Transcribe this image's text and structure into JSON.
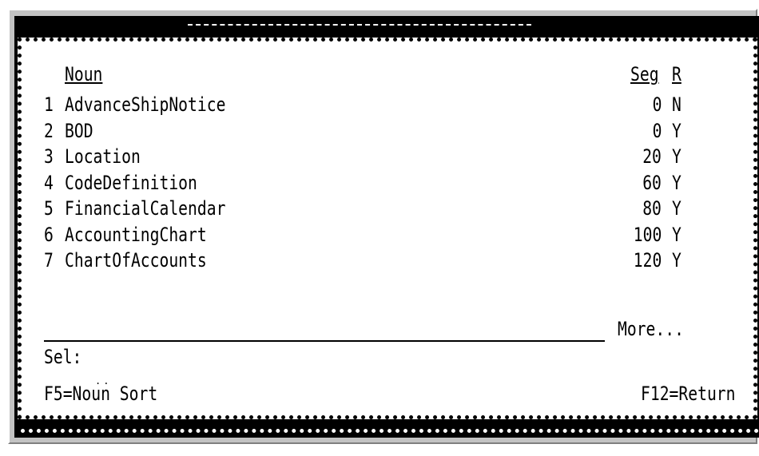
{
  "header": {
    "noun_label": "Noun",
    "seg_label": "Seg",
    "r_label": "R"
  },
  "rows": [
    {
      "num": "1",
      "noun": "AdvanceShipNotice",
      "seg": "0",
      "r": "N"
    },
    {
      "num": "2",
      "noun": "BOD",
      "seg": "0",
      "r": "Y"
    },
    {
      "num": "3",
      "noun": "Location",
      "seg": "20",
      "r": "Y"
    },
    {
      "num": "4",
      "noun": "CodeDefinition",
      "seg": "60",
      "r": "Y"
    },
    {
      "num": "5",
      "noun": "FinancialCalendar",
      "seg": "80",
      "r": "Y"
    },
    {
      "num": "6",
      "noun": "AccountingChart",
      "seg": "100",
      "r": "Y"
    },
    {
      "num": "7",
      "noun": "ChartOfAccounts",
      "seg": "120",
      "r": "Y"
    }
  ],
  "more_label": "More...",
  "sel_label": "Sel:",
  "sel_value": "",
  "footer": {
    "f5_label": "F5=Noun Sort",
    "f12_label": "F12=Return"
  }
}
